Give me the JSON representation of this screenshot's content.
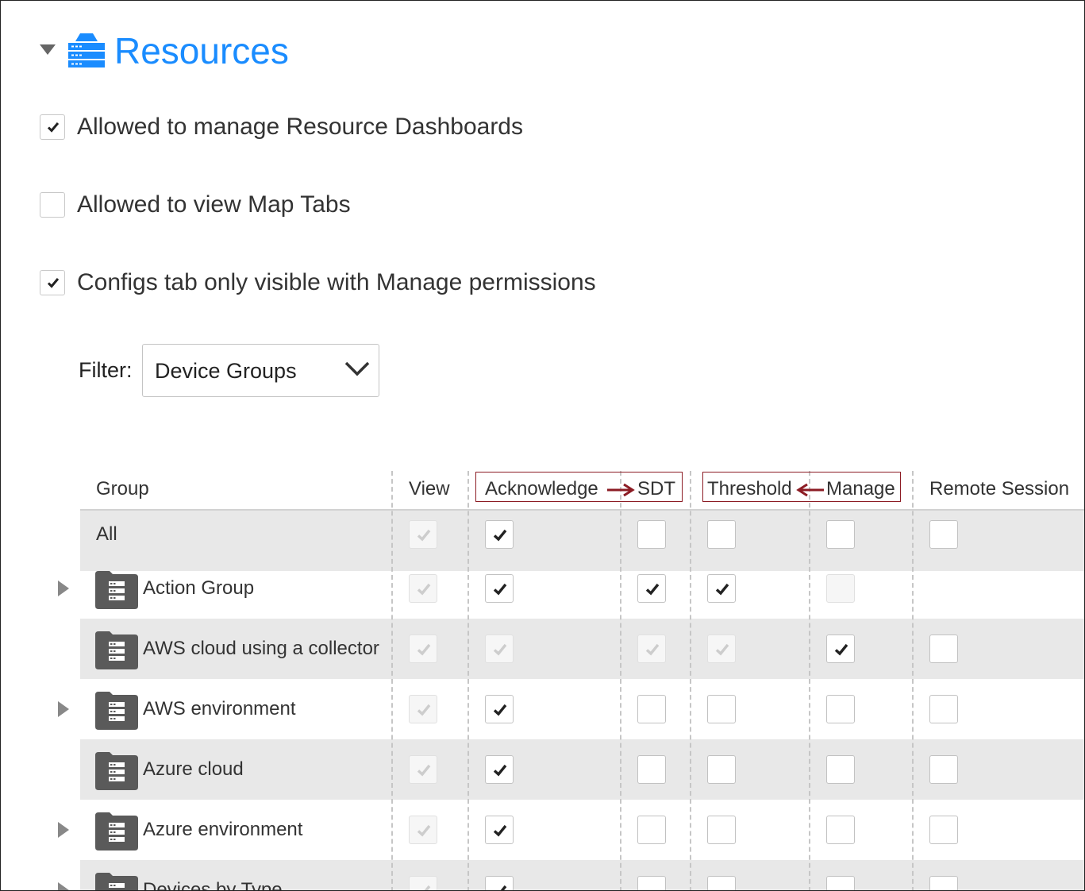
{
  "section": {
    "title": "Resources",
    "icon": "server-stack-icon",
    "accent_color": "#1a8cff"
  },
  "permissions": [
    {
      "label": "Allowed to manage Resource Dashboards",
      "checked": true
    },
    {
      "label": "Allowed to view Map Tabs",
      "checked": false
    },
    {
      "label": "Configs tab only visible with Manage permissions",
      "checked": true
    }
  ],
  "filter": {
    "label": "Filter:",
    "value": "Device Groups"
  },
  "table": {
    "headers": {
      "group": "Group",
      "view": "View",
      "acknowledge": "Acknowledge",
      "sdt": "SDT",
      "threshold": "Threshold",
      "manage": "Manage",
      "remote": "Remote Session"
    },
    "highlight_color": "#8c1c24",
    "rows": [
      {
        "name": "All",
        "expandable": false,
        "icon": false,
        "shaded": true,
        "view": "dis-checked",
        "ack": "checked",
        "sdt": "unchecked",
        "threshold": "unchecked",
        "manage": "unchecked",
        "remote": "unchecked"
      },
      {
        "name": "Action Group",
        "expandable": true,
        "icon": true,
        "shaded": false,
        "view": "dis-checked",
        "ack": "checked",
        "sdt": "checked",
        "threshold": "checked",
        "manage": "dis-unchecked",
        "remote": "none"
      },
      {
        "name": "AWS cloud using a collector",
        "expandable": false,
        "icon": true,
        "shaded": true,
        "view": "dis-checked",
        "ack": "dis-checked",
        "sdt": "dis-checked",
        "threshold": "dis-checked",
        "manage": "checked",
        "remote": "unchecked"
      },
      {
        "name": "AWS environment",
        "expandable": true,
        "icon": true,
        "shaded": false,
        "view": "dis-checked",
        "ack": "checked",
        "sdt": "unchecked",
        "threshold": "unchecked",
        "manage": "unchecked",
        "remote": "unchecked"
      },
      {
        "name": "Azure cloud",
        "expandable": false,
        "icon": true,
        "shaded": true,
        "view": "dis-checked",
        "ack": "checked",
        "sdt": "unchecked",
        "threshold": "unchecked",
        "manage": "unchecked",
        "remote": "unchecked"
      },
      {
        "name": "Azure environment",
        "expandable": true,
        "icon": true,
        "shaded": false,
        "view": "dis-checked",
        "ack": "checked",
        "sdt": "unchecked",
        "threshold": "unchecked",
        "manage": "unchecked",
        "remote": "unchecked"
      },
      {
        "name": "Devices by Type",
        "expandable": true,
        "icon": true,
        "shaded": true,
        "view": "dis-checked",
        "ack": "checked",
        "sdt": "unchecked",
        "threshold": "unchecked",
        "manage": "unchecked",
        "remote": "unchecked"
      }
    ]
  }
}
